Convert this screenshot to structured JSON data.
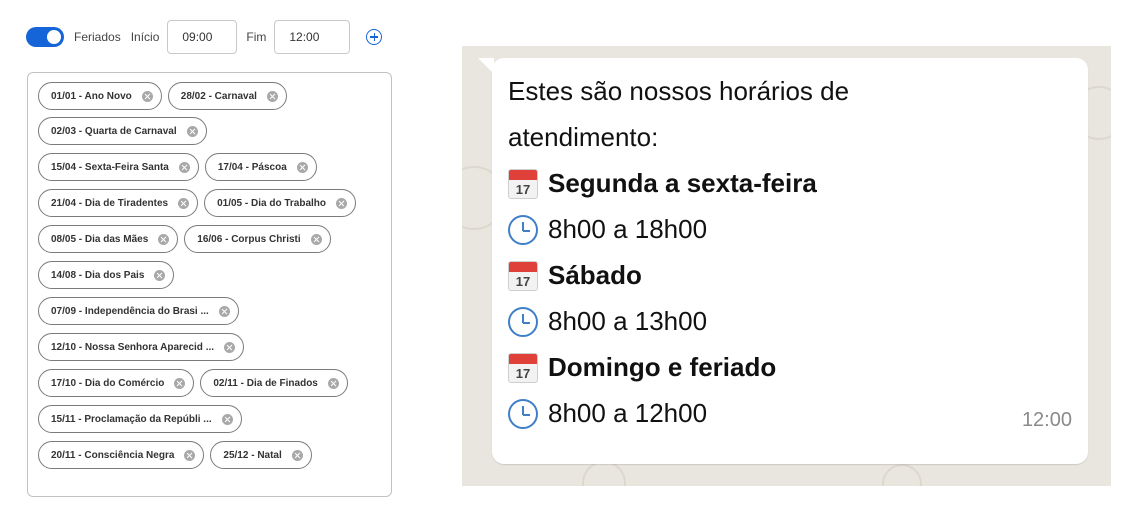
{
  "settings": {
    "holidays_toggle_label": "Feriados",
    "start_label": "Início",
    "start_value": "09:00",
    "end_label": "Fim",
    "end_value": "12:00",
    "toggle_on": true
  },
  "holidays": [
    "01/01 - Ano Novo",
    "28/02 - Carnaval",
    "02/03 - Quarta de Carnaval",
    "15/04 - Sexta-Feira Santa",
    "17/04 - Páscoa",
    "21/04 - Dia de Tiradentes",
    "01/05 - Dia do Trabalho",
    "08/05 - Dia das Mães",
    "16/06 - Corpus Christi",
    "14/08 - Dia dos Pais",
    "07/09 - Independência do Brasi ...",
    "12/10 - Nossa Senhora Aparecid ...",
    "17/10 - Dia do Comércio",
    "02/11 - Dia de Finados",
    "15/11 - Proclamação da Repúbli ...",
    "20/11 - Consciência Negra",
    "25/12 - Natal"
  ],
  "message": {
    "intro_line1": "Estes são nossos horários de",
    "intro_line2": "atendimento:",
    "calendar_icon_number": "17",
    "weekday_title": "Segunda a sexta-feira",
    "weekday_hours": "8h00 a 18h00",
    "saturday_title": "Sábado",
    "saturday_hours": "8h00 a 13h00",
    "sunday_title": "Domingo e feriado",
    "sunday_hours": "8h00 a 12h00",
    "timestamp": "12:00"
  },
  "colors": {
    "accent": "#1565d8",
    "chat_background": "#e9e6df",
    "calendar_red": "#e0403a",
    "clock_blue": "#3f7fc9"
  }
}
